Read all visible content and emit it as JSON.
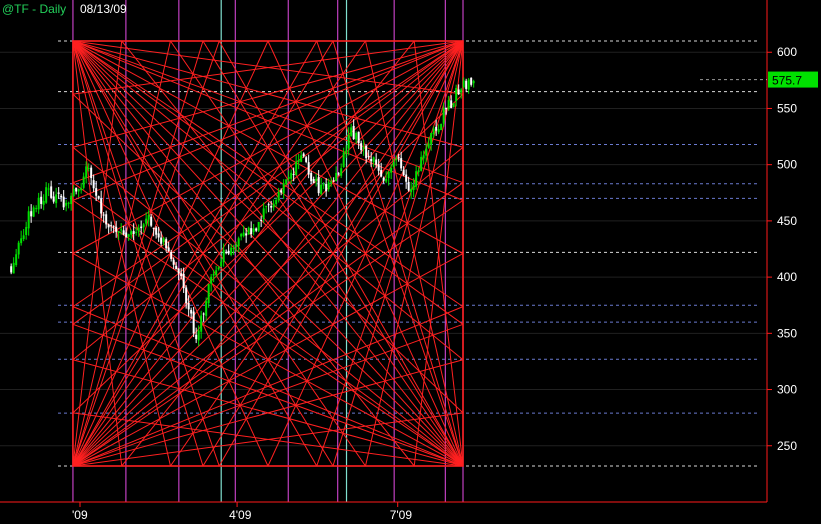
{
  "header": {
    "symbol_label": "@TF - Daily",
    "date_label": "08/13/09"
  },
  "colors": {
    "background": "#000000",
    "axis": "#ff1a1a",
    "fan_lines": "#ff2020",
    "box": "#ff2020",
    "magenta_verticals": "#c040c0",
    "cyan_verticals": "#80e0d0",
    "white_dashed": "#ffffff",
    "blue_dashed": "#6a7ad0",
    "bull_candle": "#00e000",
    "bear_candle": "#ffffff",
    "last_price_bg": "#00e000"
  },
  "chart_data": {
    "type": "candlestick",
    "title": "",
    "xlabel": "",
    "ylabel": "",
    "ylim": [
      222,
      628
    ],
    "y_ticks": [
      250,
      300,
      350,
      400,
      450,
      500,
      550,
      600
    ],
    "x_tick_labels": [
      {
        "label": "'09",
        "date": "2009-01-02"
      },
      {
        "label": "4'09",
        "date": "2009-04-01"
      },
      {
        "label": "7'09",
        "date": "2009-07-01"
      }
    ],
    "last_price": "575.7",
    "price_path": [
      {
        "date": "2008-11-24",
        "price": 410
      },
      {
        "date": "2008-12-05",
        "price": 458
      },
      {
        "date": "2008-12-15",
        "price": 478
      },
      {
        "date": "2008-12-23",
        "price": 465
      },
      {
        "date": "2009-01-02",
        "price": 478
      },
      {
        "date": "2009-01-07",
        "price": 500
      },
      {
        "date": "2009-01-12",
        "price": 468
      },
      {
        "date": "2009-01-20",
        "price": 440
      },
      {
        "date": "2009-01-28",
        "price": 440
      },
      {
        "date": "2009-02-06",
        "price": 445
      },
      {
        "date": "2009-02-09",
        "price": 458
      },
      {
        "date": "2009-02-20",
        "price": 425
      },
      {
        "date": "2009-03-02",
        "price": 390
      },
      {
        "date": "2009-03-09",
        "price": 342
      },
      {
        "date": "2009-03-16",
        "price": 390
      },
      {
        "date": "2009-03-26",
        "price": 425
      },
      {
        "date": "2009-04-09",
        "price": 440
      },
      {
        "date": "2009-04-23",
        "price": 470
      },
      {
        "date": "2009-05-08",
        "price": 505
      },
      {
        "date": "2009-05-18",
        "price": 475
      },
      {
        "date": "2009-05-29",
        "price": 495
      },
      {
        "date": "2009-06-05",
        "price": 530
      },
      {
        "date": "2009-06-12",
        "price": 510
      },
      {
        "date": "2009-06-24",
        "price": 490
      },
      {
        "date": "2009-07-01",
        "price": 505
      },
      {
        "date": "2009-07-08",
        "price": 478
      },
      {
        "date": "2009-07-15",
        "price": 510
      },
      {
        "date": "2009-07-27",
        "price": 545
      },
      {
        "date": "2009-08-06",
        "price": 570
      },
      {
        "date": "2009-08-13",
        "price": 575.7
      }
    ],
    "gann_box": {
      "date_start": "2008-12-29",
      "date_end": "2009-08-07",
      "price_low": 232,
      "price_high": 610
    },
    "magenta_verticals": [
      "2008-12-29",
      "2009-01-28",
      "2009-02-27",
      "2009-03-31",
      "2009-04-30",
      "2009-05-28",
      "2009-06-29",
      "2009-07-28",
      "2009-08-07"
    ],
    "cyan_verticals": [
      "2009-03-23",
      "2009-06-02"
    ],
    "white_dashed_levels": [
      610,
      565,
      422,
      232
    ],
    "blue_dashed_levels": [
      518,
      483,
      470,
      375,
      360,
      327,
      279
    ]
  }
}
